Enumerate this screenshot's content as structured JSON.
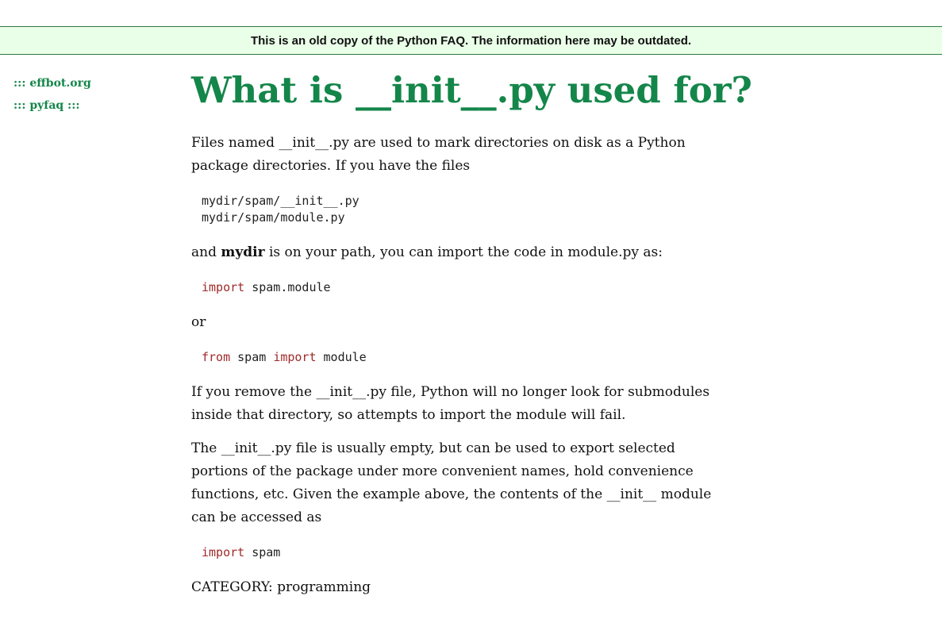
{
  "banner": {
    "text": "This is an old copy of the Python FAQ. The information here may be outdated."
  },
  "sidebar": {
    "links": [
      {
        "label": "::: effbot.org"
      },
      {
        "label": "::: pyfaq :::"
      }
    ]
  },
  "page": {
    "title": "What is __init__.py used for?"
  },
  "content": {
    "p1_line1": "Files named __init__.py are used to mark directories on disk as a Python",
    "p1_line2": "package directories. If you have the files",
    "code1_line1": "mydir/spam/__init__.py",
    "code1_line2": "mydir/spam/module.py",
    "p2_pre": "and ",
    "p2_bold": "mydir",
    "p2_post": " is on your path, you can import the code in module.py as:",
    "code2_kw1": "import",
    "code2_rest": " spam.module",
    "p3": "or",
    "code3_kw1": "from",
    "code3_mid": " spam ",
    "code3_kw2": "import",
    "code3_rest": " module",
    "p4_line1": "If you remove the __init__.py file, Python will no longer look for submodules",
    "p4_line2": "inside that directory, so attempts to import the module will fail.",
    "p5_line1": "The __init__.py file is usually empty, but can be used to export selected",
    "p5_line2": "portions of the package under more convenient names, hold convenience",
    "p5_line3": "functions, etc. Given the example above, the contents of the __init__ module",
    "p5_line4": "can be accessed as",
    "code4_kw1": "import",
    "code4_rest": " spam",
    "category": "CATEGORY: programming"
  }
}
